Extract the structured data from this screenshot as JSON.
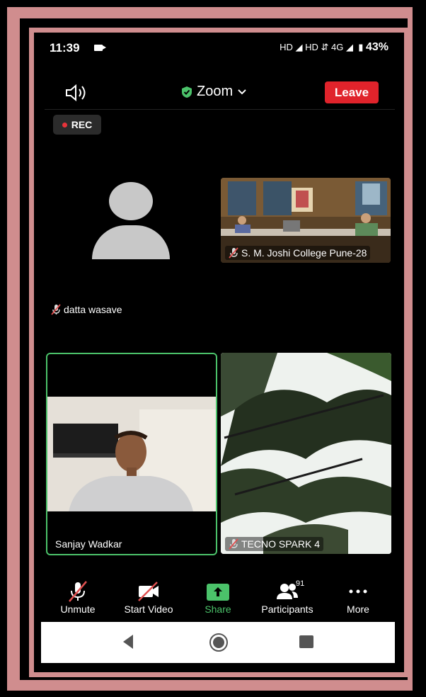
{
  "status_bar": {
    "time": "11:39",
    "right_text": "HD ◢ HD ⇵ 4G ◢",
    "battery": "43%"
  },
  "header": {
    "title": "Zoom",
    "leave_label": "Leave",
    "rec_label": "REC"
  },
  "participants": {
    "avatar_name": "datta wasave",
    "college_name": "S. M. Joshi College Pune-28",
    "sanjay_name": "Sanjay Wadkar",
    "tecno_name": "TECNO SPARK 4"
  },
  "toolbar": {
    "unmute": "Unmute",
    "start_video": "Start Video",
    "share": "Share",
    "participants": "Participants",
    "participants_count": "91",
    "more": "More"
  },
  "colors": {
    "frame": "#d08d8e",
    "leave": "#e0232b",
    "accent_green": "#4bc26a",
    "mute_red": "#e05050"
  },
  "icons": [
    "speaker-icon",
    "shield-check-icon",
    "chevron-down-icon",
    "rec-dot-icon",
    "mic-muted-icon",
    "video-off-icon",
    "share-arrow-icon",
    "participants-icon",
    "more-dots-icon",
    "back-icon",
    "home-icon",
    "recents-icon"
  ]
}
